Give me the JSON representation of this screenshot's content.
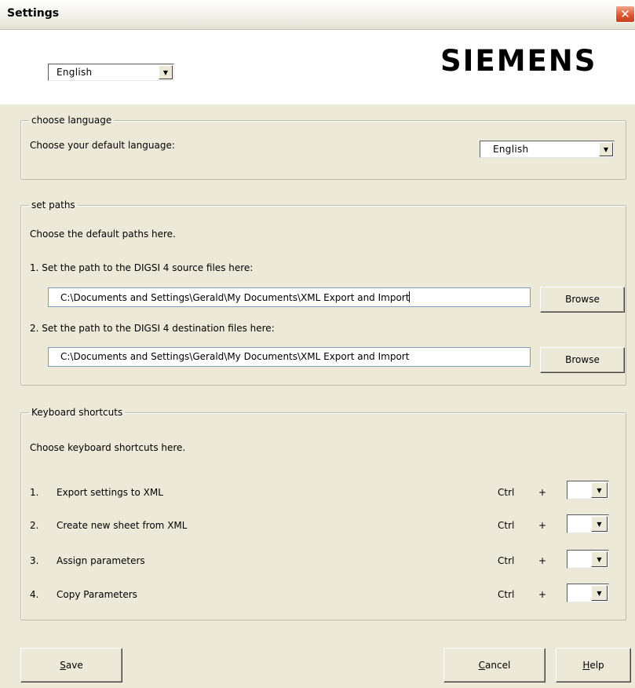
{
  "window": {
    "title": "Settings",
    "close_glyph": "✕"
  },
  "header": {
    "language_select": {
      "value": "English",
      "arrow": "▼"
    },
    "logo": "SIEMENS"
  },
  "language_group": {
    "legend": "choose language",
    "prompt": "Choose your default language:",
    "select": {
      "value": "English",
      "arrow": "▼"
    }
  },
  "paths_group": {
    "legend": "set paths",
    "intro": "Choose the default paths here.",
    "source": {
      "label": "1.  Set the path to the DIGSI 4 source files here:",
      "value": "C:\\Documents and Settings\\Gerald\\My Documents\\XML Export and Import",
      "browse_label": "Browse"
    },
    "destination": {
      "label": "2.  Set the path to the DIGSI 4 destination files here:",
      "value": "C:\\Documents and Settings\\Gerald\\My Documents\\XML Export and Import",
      "browse_label": "Browse"
    }
  },
  "shortcuts_group": {
    "legend": "Keyboard shortcuts",
    "intro": "Choose keyboard shortcuts here.",
    "rows": [
      {
        "num": "1.",
        "label": "Export settings to XML",
        "modifier": "Ctrl",
        "plus": "+",
        "key": ""
      },
      {
        "num": "2.",
        "label": "Create new sheet from XML",
        "modifier": "Ctrl",
        "plus": "+",
        "key": ""
      },
      {
        "num": "3.",
        "label": "Assign parameters",
        "modifier": "Ctrl",
        "plus": "+",
        "key": ""
      },
      {
        "num": "4.",
        "label": "Copy Parameters",
        "modifier": "Ctrl",
        "plus": "+",
        "key": ""
      }
    ],
    "arrow": "▼"
  },
  "footer": {
    "save": {
      "mnemonic": "S",
      "rest": "ave"
    },
    "cancel": {
      "mnemonic": "C",
      "rest": "ancel"
    },
    "help": {
      "mnemonic": "H",
      "rest": "elp"
    }
  }
}
